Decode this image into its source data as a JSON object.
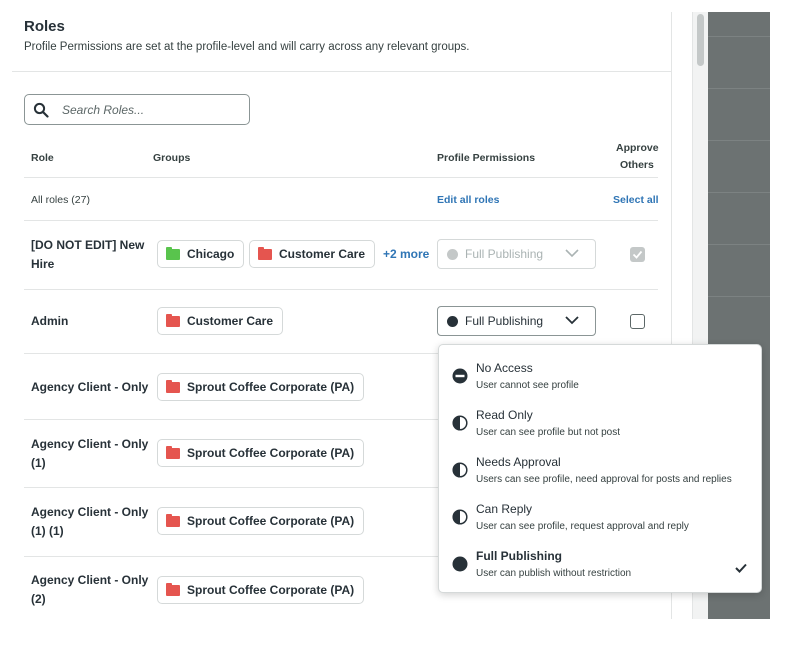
{
  "header": {
    "title": "Roles",
    "subtitle": "Profile Permissions are set at the profile-level and will carry across any relevant groups."
  },
  "search": {
    "placeholder": "Search Roles..."
  },
  "table": {
    "columns": {
      "role": "Role",
      "groups": "Groups",
      "permissions": "Profile Permissions",
      "approve_line1": "Approve",
      "approve_line2": "Others"
    },
    "all_roles_label": "All roles (27)",
    "edit_all_label": "Edit all roles",
    "select_all_label": "Select all",
    "rows": [
      {
        "role": "[DO NOT EDIT] New Hire",
        "groups": [
          "Chicago",
          "Customer Care"
        ],
        "more": "+2 more",
        "permission": "Full Publishing",
        "permission_disabled": true,
        "approve_checked": true,
        "approve_disabled": true
      },
      {
        "role": "Admin",
        "groups": [
          "Customer Care"
        ],
        "permission": "Full Publishing",
        "permission_disabled": false,
        "approve_checked": false
      },
      {
        "role": "Agency Client - Only",
        "groups": [
          "Sprout Coffee Corporate (PA)"
        ]
      },
      {
        "role": "Agency Client - Only (1)",
        "groups": [
          "Sprout Coffee Corporate (PA)"
        ]
      },
      {
        "role": "Agency Client - Only (1) (1)",
        "groups": [
          "Sprout Coffee Corporate (PA)"
        ]
      },
      {
        "role": "Agency Client - Only (2)",
        "groups": [
          "Sprout Coffee Corporate (PA)"
        ]
      }
    ]
  },
  "permission_menu": {
    "selected": "Full Publishing",
    "options": [
      {
        "label": "No Access",
        "description": "User cannot see profile",
        "icon": "no-access-icon"
      },
      {
        "label": "Read Only",
        "description": "User can see profile but not post",
        "icon": "half-circle-icon"
      },
      {
        "label": "Needs Approval",
        "description": "Users can see profile, need approval for posts and replies",
        "icon": "half-circle-icon"
      },
      {
        "label": "Can Reply",
        "description": "User can see profile, request approval and reply",
        "icon": "half-circle-icon"
      },
      {
        "label": "Full Publishing",
        "description": "User can publish without restriction",
        "icon": "full-circle-icon"
      }
    ]
  },
  "colors": {
    "link": "#2f75b5",
    "folder_red": "#e5554f",
    "folder_green": "#59c44d",
    "side_panel": "#6c7272"
  }
}
